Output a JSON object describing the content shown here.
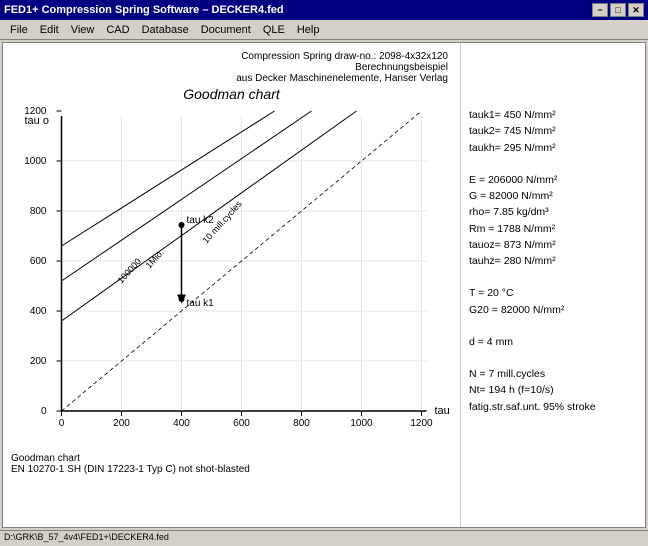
{
  "window": {
    "title": "FED1+ Compression Spring Software – DECKER4.fed",
    "min_btn": "−",
    "max_btn": "□",
    "close_btn": "✕"
  },
  "menu": {
    "items": [
      "File",
      "Edit",
      "View",
      "CAD",
      "Database",
      "Document",
      "QLE",
      "Help"
    ]
  },
  "info": {
    "draw_no_label": "Compression Spring   draw-no.: 2098-4x32x120",
    "desc1": "Berechnungsbeispiel",
    "desc2": "aus Decker Maschinenelemente, Hanser Verlag",
    "tauk1": "tauk1=  450 N/mm²",
    "tauk2": "tauk2=  745 N/mm²",
    "taukh": "taukh=  295 N/mm²",
    "E": "E = 206000 N/mm²",
    "G": "G =  82000 N/mm²",
    "rho": "rho=   7.85 kg/dm³",
    "Rm": "Rm =  1788 N/mm²",
    "tauoz": "tauoz=  873 N/mm²",
    "tauhz": "tauhz=  280 N/mm²",
    "T": "T =  20 °C",
    "G20": "G20 = 82000 N/mm²",
    "d": "d =  4 mm",
    "N": "N =  7 mill.cycles",
    "Nt": "Nt=  194 h  (f=10/s)",
    "fatig": "fatig.str.saf.unt. 95% stroke"
  },
  "chart": {
    "title": "Goodman chart",
    "x_axis_label": "tau u",
    "y_axis_label": "tau o",
    "x_ticks": [
      0,
      200,
      400,
      600,
      800,
      1000,
      1200
    ],
    "y_ticks": [
      0,
      200,
      400,
      600,
      800,
      1000,
      1200
    ],
    "cycle_labels": [
      "100000",
      "1Mio.",
      "10 mill.cycles"
    ],
    "tau_k2_label": "tau k2",
    "tau_k1_label": "tau k1"
  },
  "bottom": {
    "line1": "Goodman chart",
    "line2": "EN 10270-1 SH (DIN 17223-1 Typ C) not shot-blasted"
  },
  "statusbar": {
    "text": "D:\\GRK\\B_57_4v4\\FED1+\\DECKER4.fed"
  }
}
